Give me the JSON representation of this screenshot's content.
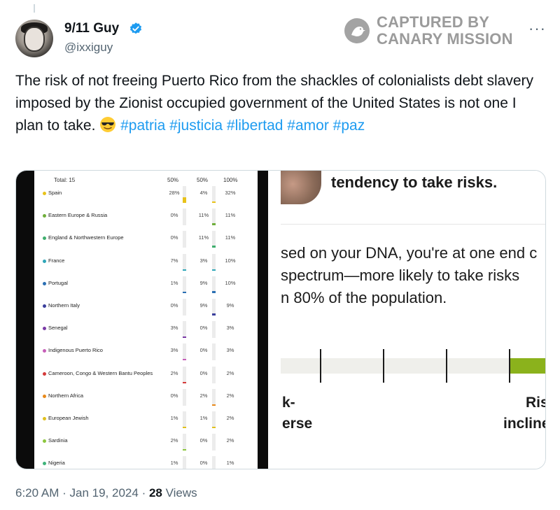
{
  "author": {
    "display_name": "9/11 Guy",
    "handle": "@ixxiguy",
    "verified": true
  },
  "watermark": {
    "line1": "CAPTURED BY",
    "line2": "CANARY MISSION"
  },
  "more_icon": "···",
  "tweet": {
    "text": "The risk of not freeing Puerto Rico from the shackles of colonialists debt slavery imposed by the Zionist occupied government of the United States is not one I plan to take.",
    "emoji": "smiling-face-with-sunglasses",
    "hashtags": [
      "#patria",
      "#justicia",
      "#libertad",
      "#amor",
      "#paz"
    ]
  },
  "ancestry": {
    "total_label": "Total: 15",
    "col_headers": [
      "50%",
      "50%",
      "100%"
    ],
    "rows": [
      {
        "label": "Spain",
        "a": "28%",
        "b": "4%",
        "c": "32%",
        "color": "#e8c21a",
        "fill_a": 0.28,
        "fill_b": 0.04
      },
      {
        "label": "Eastern Europe & Russia",
        "a": "0%",
        "b": "11%",
        "c": "11%",
        "color": "#6fae3b",
        "fill_a": 0.0,
        "fill_b": 0.11
      },
      {
        "label": "England & Northwestern Europe",
        "a": "0%",
        "b": "11%",
        "c": "11%",
        "color": "#3fae6e",
        "fill_a": 0.0,
        "fill_b": 0.11
      },
      {
        "label": "France",
        "a": "7%",
        "b": "3%",
        "c": "10%",
        "color": "#2fa6b8",
        "fill_a": 0.07,
        "fill_b": 0.03
      },
      {
        "label": "Portugal",
        "a": "1%",
        "b": "9%",
        "c": "10%",
        "color": "#2a6fb3",
        "fill_a": 0.01,
        "fill_b": 0.09
      },
      {
        "label": "Northern Italy",
        "a": "0%",
        "b": "9%",
        "c": "9%",
        "color": "#3b3f9c",
        "fill_a": 0.0,
        "fill_b": 0.09
      },
      {
        "label": "Senegal",
        "a": "3%",
        "b": "0%",
        "c": "3%",
        "color": "#7a3aa6",
        "fill_a": 0.03,
        "fill_b": 0.0
      },
      {
        "label": "Indigenous Puerto Rico",
        "a": "3%",
        "b": "0%",
        "c": "3%",
        "color": "#c65fb8",
        "fill_a": 0.03,
        "fill_b": 0.0
      },
      {
        "label": "Cameroon, Congo & Western Bantu Peoples",
        "a": "2%",
        "b": "0%",
        "c": "2%",
        "color": "#d43a3a",
        "fill_a": 0.02,
        "fill_b": 0.0
      },
      {
        "label": "Northern Africa",
        "a": "0%",
        "b": "2%",
        "c": "2%",
        "color": "#e8891a",
        "fill_a": 0.0,
        "fill_b": 0.02
      },
      {
        "label": "European Jewish",
        "a": "1%",
        "b": "1%",
        "c": "2%",
        "color": "#e0c01e",
        "fill_a": 0.01,
        "fill_b": 0.01
      },
      {
        "label": "Sardinia",
        "a": "2%",
        "b": "0%",
        "c": "2%",
        "color": "#8cc63f",
        "fill_a": 0.02,
        "fill_b": 0.0
      },
      {
        "label": "Nigeria",
        "a": "1%",
        "b": "0%",
        "c": "1%",
        "color": "#3fb37a",
        "fill_a": 0.01,
        "fill_b": 0.0
      }
    ]
  },
  "dna_panel": {
    "title": "tendency to take risks.",
    "body_lines": [
      "sed on your DNA, you're at one end c",
      " spectrum—more likely to take risks",
      "n 80% of the population."
    ],
    "left_label_1": "k-",
    "left_label_2": "erse",
    "right_label_1": "Ris",
    "right_label_2": "incline",
    "accent_color": "#8bb21c"
  },
  "footer": {
    "time": "6:20 AM",
    "sep": "·",
    "date": "Jan 19, 2024",
    "views_count": "28",
    "views_label": "Views"
  }
}
